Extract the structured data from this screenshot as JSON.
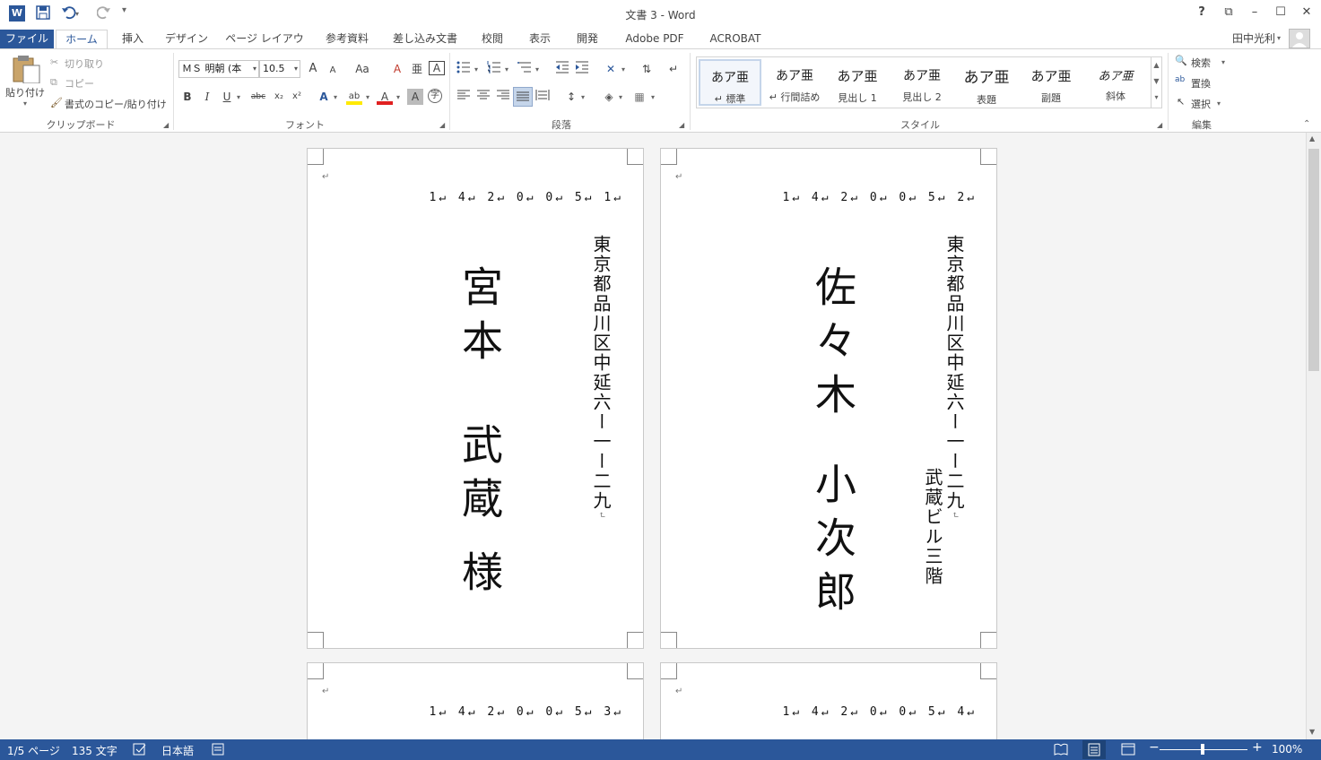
{
  "window": {
    "title": "文書 3 - Word",
    "quick_access": {
      "word_icon": "W",
      "save_icon": "save-icon",
      "undo_icon": "undo-icon",
      "redo_icon": "redo-icon",
      "customize": "▾"
    },
    "controls": {
      "help": "?",
      "ribbon_options": "⧉",
      "minimize": "–",
      "maximize": "☐",
      "close": "✕"
    }
  },
  "tabs": [
    "ファイル",
    "ホーム",
    "挿入",
    "デザイン",
    "ページ レイアウト",
    "参考資料",
    "差し込み文書",
    "校閲",
    "表示",
    "開発",
    "Adobe PDF",
    "ACROBAT"
  ],
  "user": {
    "name": "田中光利"
  },
  "ribbon": {
    "clipboard": {
      "label": "クリップボード",
      "paste": "貼り付け",
      "cut": "切り取り",
      "copy": "コピー",
      "format_painter": "書式のコピー/貼り付け"
    },
    "font": {
      "label": "フォント",
      "font_name": "ＭＳ 明朝 (本",
      "font_size": "10.5",
      "bold": "B",
      "italic": "I",
      "underline": "U",
      "strike": "abc",
      "sub": "x₂",
      "sup": "x²",
      "grow": "A",
      "shrink": "A",
      "case": "Aa",
      "clear": "A",
      "phonetic": "亜",
      "border_char": "A",
      "text_effect": "A",
      "highlight": "ab",
      "font_color": "A",
      "shading": "A",
      "enclose": "字"
    },
    "paragraph": {
      "label": "段落"
    },
    "styles": {
      "label": "スタイル",
      "items": [
        {
          "preview": "あア亜",
          "name": "↵ 標準"
        },
        {
          "preview": "あア亜",
          "name": "↵ 行間詰め"
        },
        {
          "preview": "あア亜",
          "name": "見出し 1"
        },
        {
          "preview": "あア亜",
          "name": "見出し 2"
        },
        {
          "preview": "あア亜",
          "name": "表題"
        },
        {
          "preview": "あア亜",
          "name": "副題"
        },
        {
          "preview": "あア亜",
          "name": "斜体"
        }
      ]
    },
    "editing": {
      "label": "編集",
      "find": "検索",
      "replace": "置換",
      "select": "選択"
    }
  },
  "pages": [
    {
      "para_mark": "↵",
      "zip": "1↵ 4↵ 2↵ 0↵ 0↵ 5↵ 1↵",
      "address": "東京都品川区中延六ー一ー二九",
      "address_end": "↵",
      "address2": "",
      "name_lines": [
        "宮本",
        "武蔵",
        "様"
      ]
    },
    {
      "para_mark": "↵",
      "zip": "1↵ 4↵ 2↵ 0↵ 0↵ 5↵ 2↵",
      "address": "東京都品川区中延六ー一ー二九",
      "address_end": "↵",
      "address2": "武蔵ビル三階",
      "name_lines": [
        "佐々木",
        "小次郎"
      ]
    },
    {
      "para_mark": "↵",
      "zip": "1↵ 4↵ 2↵ 0↵ 0↵ 5↵ 3↵"
    },
    {
      "para_mark": "↵",
      "zip": "1↵ 4↵ 2↵ 0↵ 0↵ 5↵ 4↵"
    }
  ],
  "status": {
    "page": "1/5 ページ",
    "words": "135 文字",
    "language": "日本語",
    "zoom": "100%",
    "zoom_minus": "−",
    "zoom_plus": "+"
  }
}
